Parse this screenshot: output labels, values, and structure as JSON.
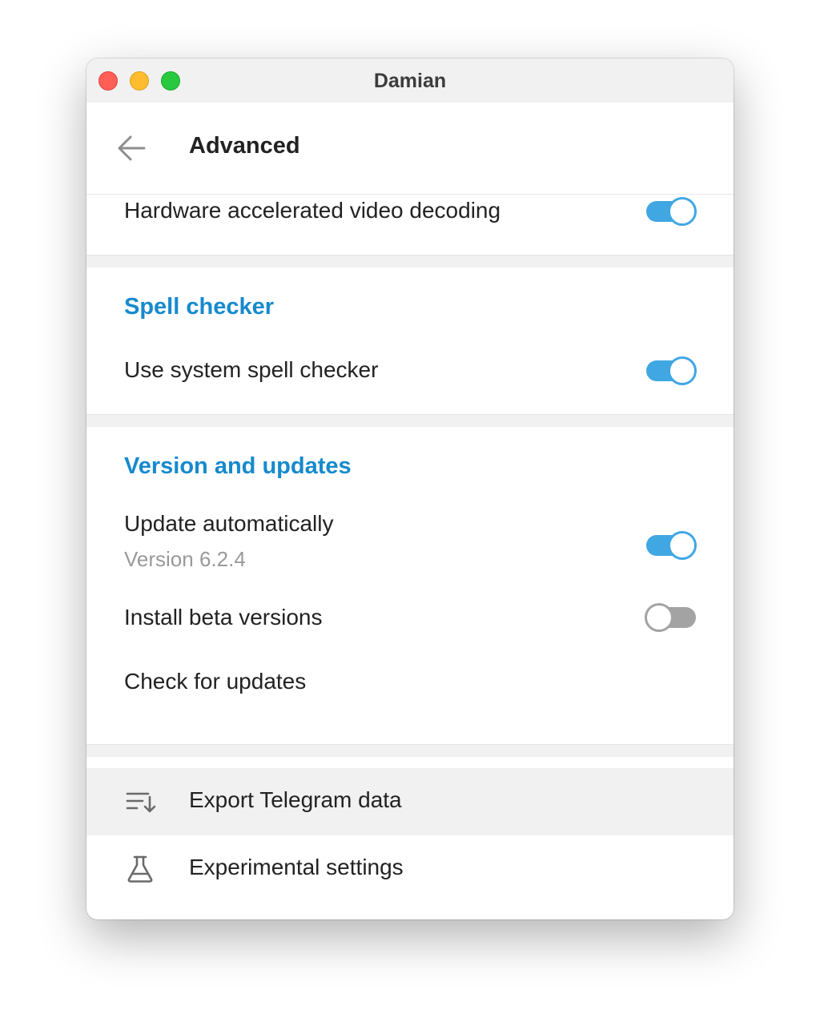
{
  "window": {
    "title": "Damian"
  },
  "header": {
    "title": "Advanced",
    "back_icon": "arrow-left-icon"
  },
  "video": {
    "hw_decoding_label": "Hardware accelerated video decoding",
    "hw_decoding_enabled": true
  },
  "spell_checker": {
    "title": "Spell checker",
    "use_system_label": "Use system spell checker",
    "use_system_enabled": true
  },
  "updates": {
    "title": "Version and updates",
    "auto_update_label": "Update automatically",
    "version_text": "Version 6.2.4",
    "auto_update_enabled": true,
    "beta_label": "Install beta versions",
    "beta_enabled": false,
    "check_label": "Check for updates"
  },
  "menu": {
    "items": [
      {
        "label": "Export Telegram data",
        "icon": "export-list-icon"
      },
      {
        "label": "Experimental settings",
        "icon": "flask-icon"
      }
    ]
  },
  "colors": {
    "accent": "#168acd",
    "toggle_on": "#40a7e3",
    "toggle_off": "#a3a3a3"
  }
}
